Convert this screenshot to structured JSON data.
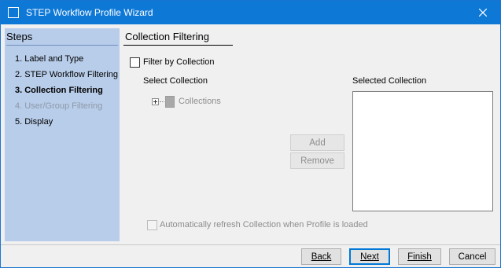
{
  "window": {
    "title": "STEP Workflow Profile Wizard"
  },
  "steps": {
    "heading": "Steps",
    "items": [
      {
        "label": "1. Label and Type",
        "state": "normal"
      },
      {
        "label": "2. STEP Workflow Filtering",
        "state": "normal"
      },
      {
        "label": "3. Collection Filtering",
        "state": "current"
      },
      {
        "label": "4. User/Group Filtering",
        "state": "disabled"
      },
      {
        "label": "5. Display",
        "state": "normal"
      }
    ]
  },
  "page": {
    "title": "Collection Filtering",
    "filter_checkbox_label": "Filter by Collection",
    "filter_checked": false,
    "select_collection_label": "Select Collection",
    "selected_collection_label": "Selected Collection",
    "tree_root_label": "Collections",
    "add_label": "Add",
    "remove_label": "Remove",
    "auto_refresh_label": "Automatically refresh Collection when Profile is loaded",
    "auto_refresh_checked": false
  },
  "footer": {
    "back_label": "Back",
    "next_label": "Next",
    "finish_label": "Finish",
    "cancel_label": "Cancel"
  },
  "colors": {
    "titlebar": "#0e78d7",
    "steps_panel": "#b8cdea",
    "window_bg": "#f0f0f0"
  }
}
